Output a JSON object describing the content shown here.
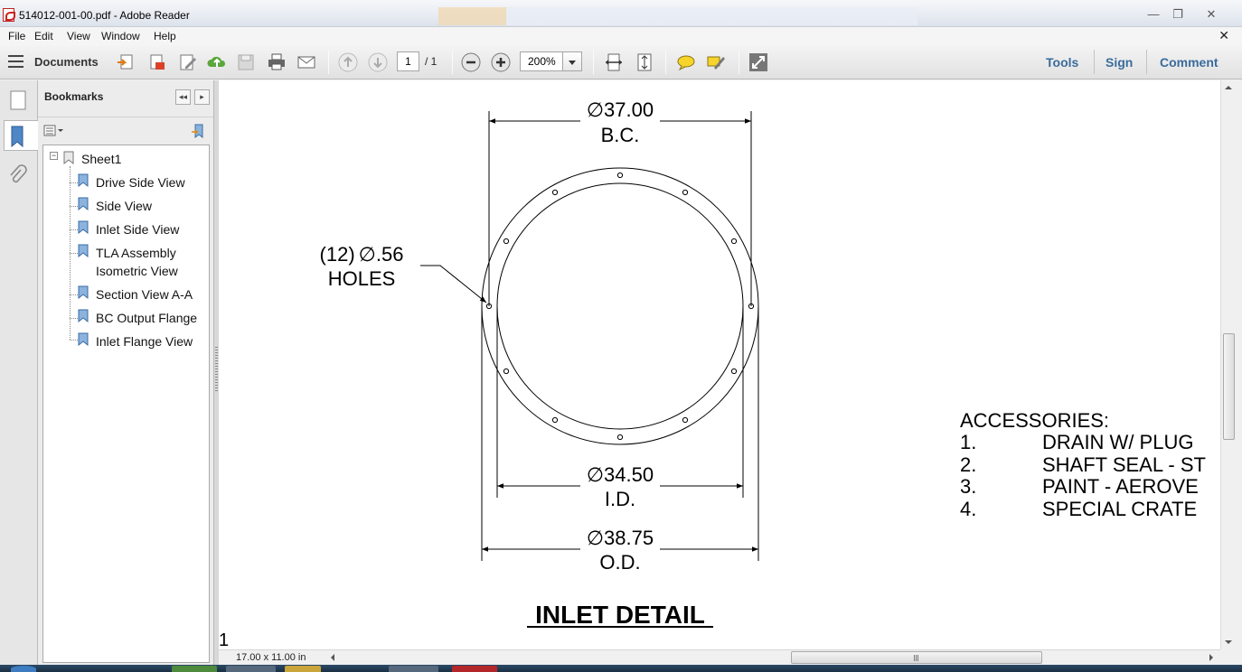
{
  "window": {
    "title": "514012-001-00.pdf - Adobe Reader",
    "buttons": {
      "minimize": "—",
      "maximize": "❐",
      "close": "✕"
    }
  },
  "menu": {
    "items": [
      "File",
      "Edit",
      "View",
      "Window",
      "Help"
    ],
    "close_doc": "✕"
  },
  "toolbar": {
    "documents_label": "Documents",
    "page_current": "1",
    "page_total": "/ 1",
    "zoom": "200%",
    "right_links": [
      "Tools",
      "Sign",
      "Comment"
    ]
  },
  "bookmarks": {
    "header": "Bookmarks",
    "nav_collapse": "◂◂",
    "nav_hide": "▸",
    "root": "Sheet1",
    "items": [
      "Drive Side View",
      "Side View",
      "Inlet Side View",
      "TLA Assembly",
      "Isometric View",
      "Section View A-A",
      "BC Output Flange",
      "Inlet Flange View"
    ]
  },
  "drawing": {
    "bc_dim": "37.00",
    "bc_label": "B.C.",
    "holes_qty": "(12)",
    "holes_dim": ".56",
    "holes_label": "HOLES",
    "id_dim": "34.50",
    "id_label": "I.D.",
    "od_dim": "38.75",
    "od_label": "O.D.",
    "diameter_symbol": "∅",
    "detail_title": "INLET DETAIL",
    "accessories_title": "ACCESSORIES:",
    "accessories": [
      {
        "num": "1.",
        "text": "DRAIN W/ PLUG"
      },
      {
        "num": "2.",
        "text": "SHAFT SEAL - ST"
      },
      {
        "num": "3.",
        "text": "PAINT - AEROVE"
      },
      {
        "num": "4.",
        "text": "SPECIAL CRATE"
      }
    ],
    "page_number": "1"
  },
  "status": {
    "page_size": "17.00 x 11.00 in"
  }
}
